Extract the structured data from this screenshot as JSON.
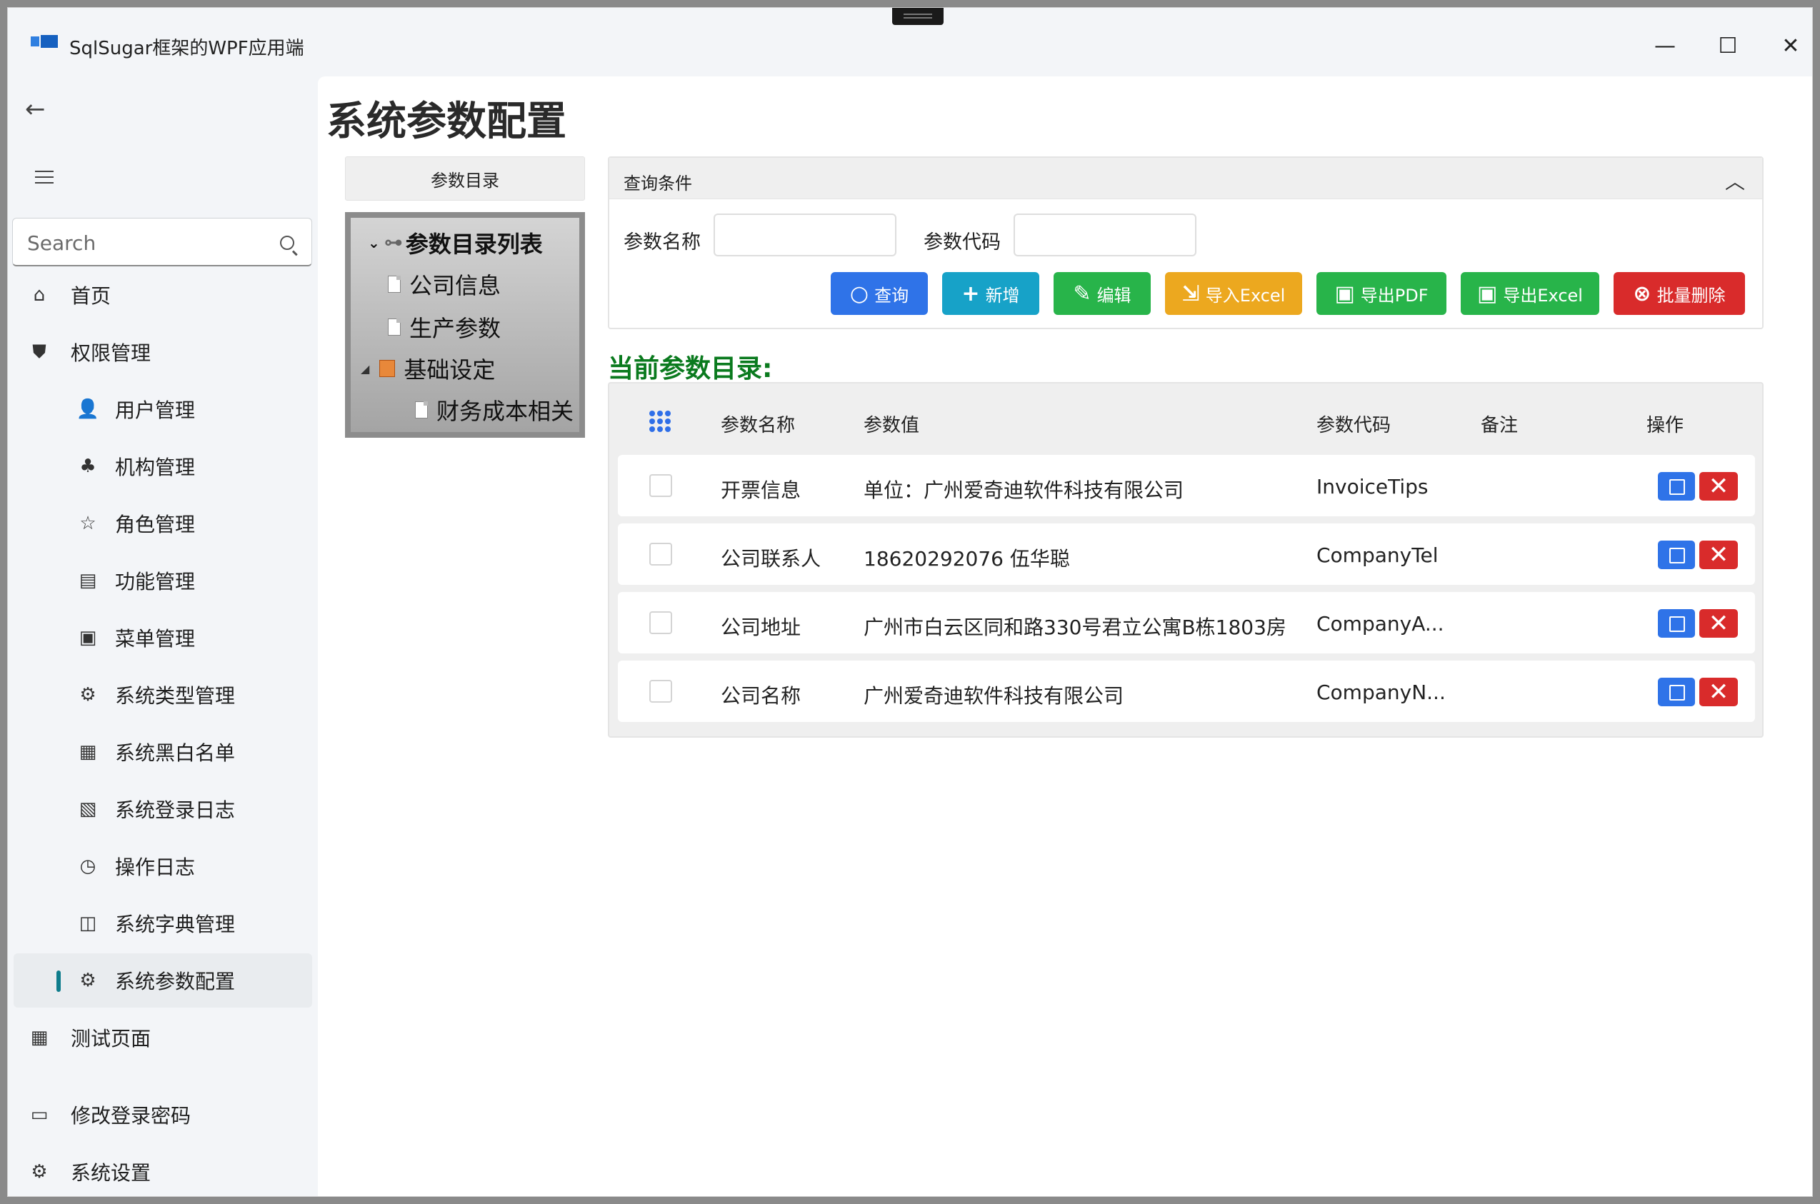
{
  "window": {
    "title": "SqlSugar框架的WPF应用端",
    "minimize": "—",
    "maximize": "☐",
    "close": "✕"
  },
  "sidebar": {
    "back": "←",
    "search_placeholder": "Search",
    "items": [
      {
        "label": "首页",
        "icon": "⌂"
      },
      {
        "label": "权限管理",
        "icon": "⛊"
      },
      {
        "label": "用户管理",
        "icon": "👤"
      },
      {
        "label": "机构管理",
        "icon": "♣"
      },
      {
        "label": "角色管理",
        "icon": "☆"
      },
      {
        "label": "功能管理",
        "icon": "▤"
      },
      {
        "label": "菜单管理",
        "icon": "▣"
      },
      {
        "label": "系统类型管理",
        "icon": "⚙"
      },
      {
        "label": "系统黑白名单",
        "icon": "▦"
      },
      {
        "label": "系统登录日志",
        "icon": "▧"
      },
      {
        "label": "操作日志",
        "icon": "◷"
      },
      {
        "label": "系统字典管理",
        "icon": "◫"
      },
      {
        "label": "系统参数配置",
        "icon": "⚙"
      },
      {
        "label": "测试页面",
        "icon": "▦"
      },
      {
        "label": "修改登录密码",
        "icon": "▭"
      },
      {
        "label": "系统设置",
        "icon": "⚙"
      }
    ]
  },
  "page": {
    "title": "系统参数配置"
  },
  "tree": {
    "header": "参数目录",
    "root": "参数目录列表",
    "nodes": [
      "公司信息",
      "生产参数",
      "基础设定",
      "财务成本相关"
    ]
  },
  "query": {
    "title": "查询条件",
    "collapse": "︿",
    "name_label": "参数名称",
    "code_label": "参数代码",
    "buttons": {
      "search": "查询",
      "add": "新增",
      "edit": "编辑",
      "import": "导入Excel",
      "export_pdf": "导出PDF",
      "export_excel": "导出Excel",
      "batch_delete": "批量删除"
    },
    "colors": {
      "search": "#2f73e8",
      "add": "#17a2c8",
      "edit": "#28b44a",
      "import": "#eca81f",
      "export": "#28b44a",
      "delete": "#d92b2b"
    }
  },
  "section_title": "当前参数目录:",
  "table": {
    "columns": [
      "参数名称",
      "参数值",
      "参数代码",
      "备注",
      "操作"
    ],
    "rows": [
      {
        "name": "开票信息",
        "value": "单位：广州爱奇迪软件科技有限公司",
        "code": "InvoiceTips",
        "remark": ""
      },
      {
        "name": "公司联系人",
        "value": "18620292076 伍华聪",
        "code": "CompanyTel",
        "remark": ""
      },
      {
        "name": "公司地址",
        "value": "广州市白云区同和路330号君立公寓B栋1803房",
        "code": "CompanyA...",
        "remark": ""
      },
      {
        "name": "公司名称",
        "value": "广州爱奇迪软件科技有限公司",
        "code": "CompanyN...",
        "remark": ""
      }
    ],
    "delete_glyph": "✕"
  }
}
